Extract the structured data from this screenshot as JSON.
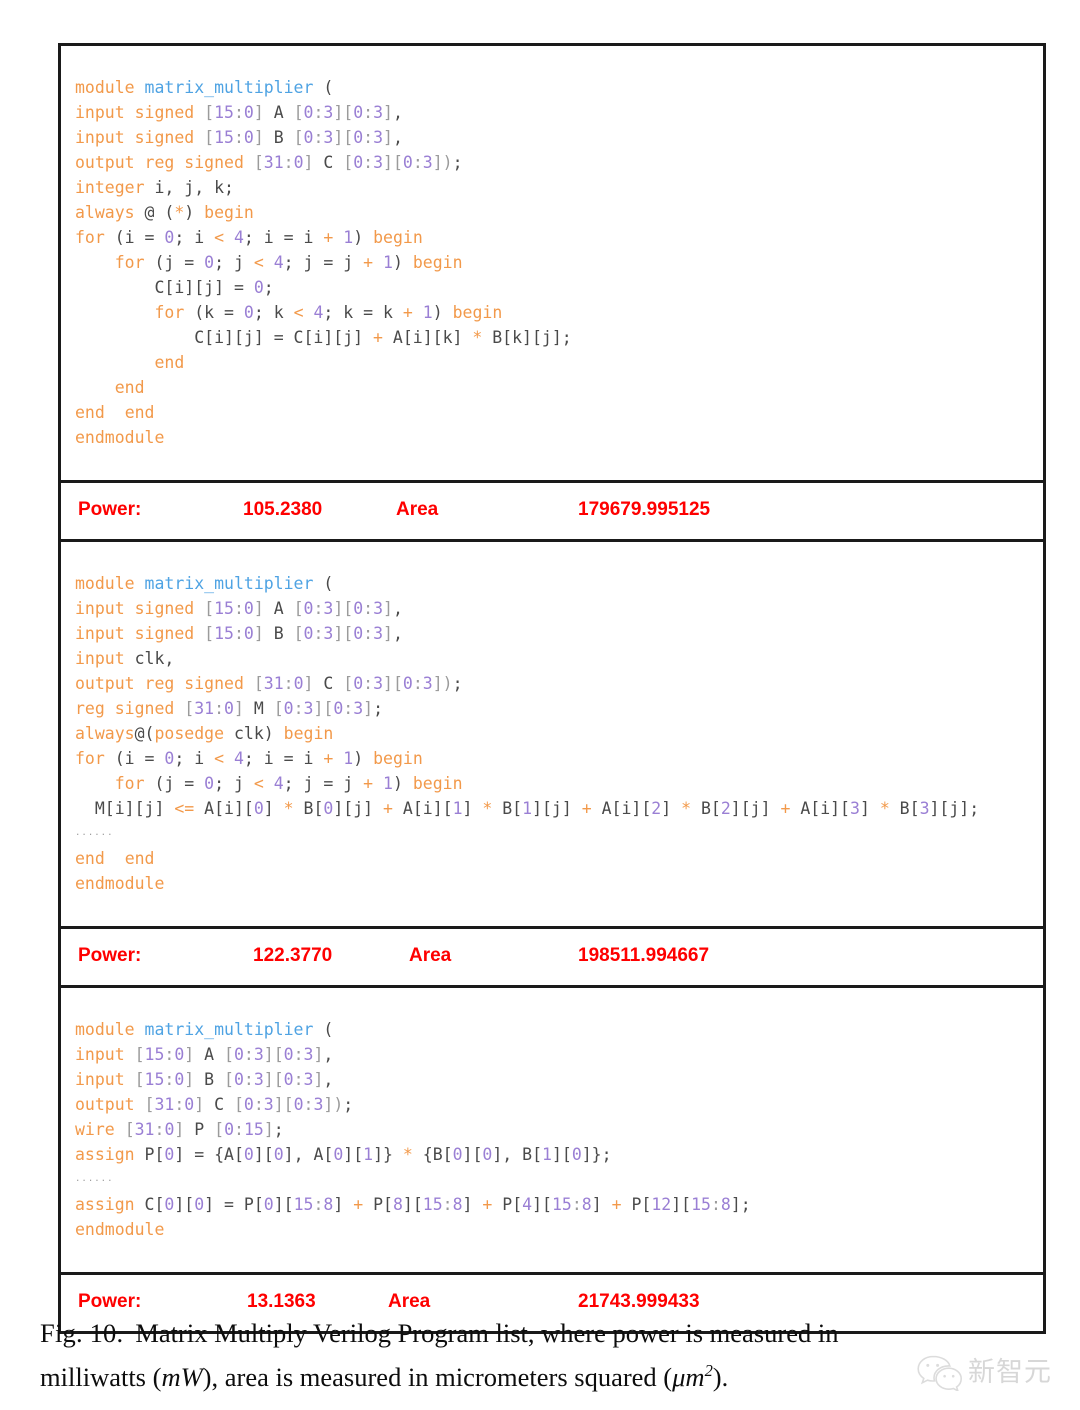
{
  "figure": {
    "caption_label": "Fig. 10.",
    "caption_text_1": "Matrix Multiply Verilog Program list, where power is measured in",
    "caption_text_2a": "milliwatts (",
    "caption_math_1": "mW",
    "caption_text_2b": "), area is measured in micrometers squared (",
    "caption_math_2": "μm",
    "caption_math_2_sup": "2",
    "caption_text_2c": ")."
  },
  "colors": {
    "keyword": "#f2994a",
    "identifier": "#4fa3e3",
    "number": "#9a7fd4",
    "bracket": "#9b9b9b",
    "plain": "#4a4a4a",
    "metric_red": "#fe0000",
    "border": "#1a1a1a",
    "background": "#ffffff"
  },
  "blocks": [
    {
      "id": "program-1",
      "code_lines": [
        "module matrix_multiplier (",
        "input signed [15:0] A [0:3][0:3],",
        "input signed [15:0] B [0:3][0:3],",
        "output reg signed [31:0] C [0:3][0:3]);",
        "integer i, j, k;",
        "always @ (*) begin",
        "for (i = 0; i < 4; i = i + 1) begin",
        "    for (j = 0; j < 4; j = j + 1) begin",
        "        C[i][j] = 0;",
        "        for (k = 0; k < 4; k = k + 1) begin",
        "            C[i][j] = C[i][j] + A[i][k] * B[k][j];",
        "        end",
        "    end",
        "end  end",
        "endmodule"
      ],
      "metrics": {
        "power_label": "Power:",
        "power_value": "105.2380",
        "area_label": "Area",
        "area_value": "179679.995125"
      }
    },
    {
      "id": "program-2",
      "code_lines": [
        "module matrix_multiplier (",
        "input signed [15:0] A [0:3][0:3],",
        "input signed [15:0] B [0:3][0:3],",
        "input clk,",
        "output reg signed [31:0] C [0:3][0:3]);",
        "reg signed [31:0] M [0:3][0:3];",
        "always@(posedge clk) begin",
        "for (i = 0; i < 4; i = i + 1) begin",
        "    for (j = 0; j < 4; j = j + 1) begin",
        "    M[i][j] <= A[i][0] * B[0][j] + A[i][1] * B[1][j] + A[i][2] * B[2][j] + A[i][3] * B[3][j];",
        "......",
        "end  end",
        "endmodule"
      ],
      "metrics": {
        "power_label": "Power:",
        "power_value": "122.3770",
        "area_label": "Area",
        "area_value": "198511.994667"
      }
    },
    {
      "id": "program-3",
      "code_lines": [
        "module matrix_multiplier (",
        "input [15:0] A [0:3][0:3],",
        "input [15:0] B [0:3][0:3],",
        "output [31:0] C [0:3][0:3]);",
        "wire [31:0] P [0:15];",
        "assign P[0] = {A[0][0], A[0][1]} * {B[0][0], B[1][0]};",
        "......",
        "assign C[0][0] = P[0][15:8] + P[8][15:8] + P[4][15:8] + P[12][15:8];",
        "endmodule"
      ],
      "metrics": {
        "power_label": "Power:",
        "power_value": "13.1363",
        "area_label": "Area",
        "area_value": "21743.999433"
      }
    }
  ],
  "watermark": {
    "logo": "wechat-logo-icon",
    "text": "新智元"
  }
}
